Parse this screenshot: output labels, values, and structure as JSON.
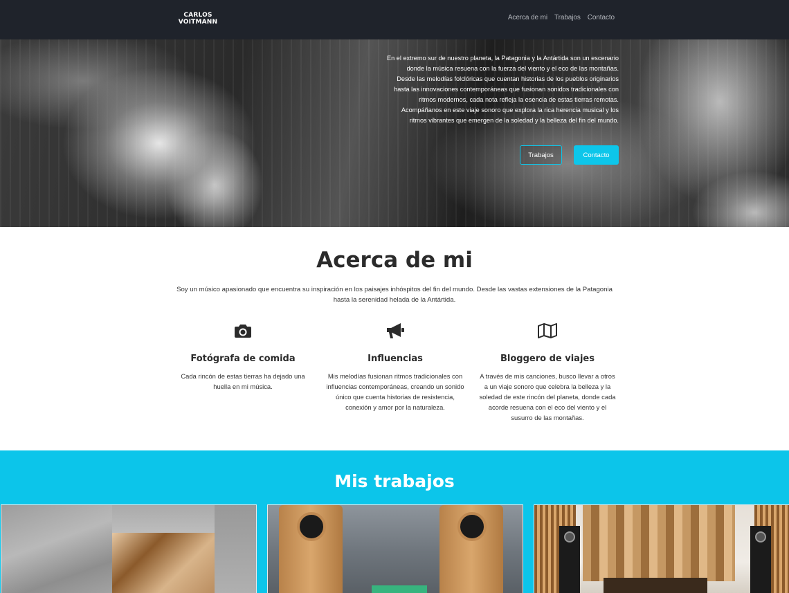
{
  "nav": {
    "logo_line1": "CARLOS",
    "logo_line2": "VOITMANN",
    "links": [
      "Acerca de mi",
      "Trabajos",
      "Contacto"
    ]
  },
  "hero": {
    "lines": [
      "En el extremo sur de nuestro planeta, la Patagonia y la Antártida son un escenario",
      "donde la música resuena con la fuerza del viento y el eco de las montañas.",
      "Desde las melodías folclóricas que cuentan historias de los pueblos originarios",
      "hasta las innovaciones contemporáneas que fusionan sonidos tradicionales con",
      "ritmos modernos, cada nota refleja la esencia de estas tierras remotas.",
      "Acompáñanos en este viaje sonoro que explora la rica herencia musical y los",
      "ritmos vibrantes que emergen de la soledad y la belleza del fin del mundo."
    ],
    "btn_works": "Trabajos",
    "btn_contact": "Contacto"
  },
  "about": {
    "title": "Acerca de mi",
    "lead": "Soy un músico apasionado que encuentra su inspiración en los paisajes inhóspitos del fin del mundo. Desde las vastas extensiones de la Patagonia hasta la serenidad helada de la Antártida.",
    "features": [
      {
        "icon": "camera-icon",
        "title": "Fotógrafa de comida",
        "text": "Cada rincón de estas tierras ha dejado una huella en mi música."
      },
      {
        "icon": "megaphone-icon",
        "title": "Influencias",
        "text": "Mis melodías fusionan ritmos tradicionales con influencias contemporáneas, creando un sonido único que cuenta historias de resistencia, conexión y amor por la naturaleza."
      },
      {
        "icon": "map-icon",
        "title": "Bloggero de viajes",
        "text": "A través de mis canciones, busco llevar a otros a un viaje sonoro que celebra la belleza y la soledad de este rincón del planeta, donde cada acorde resuena con el eco del viento y el susurro de las montañas."
      }
    ]
  },
  "works": {
    "title": "Mis trabajos"
  },
  "colors": {
    "accent": "#0dc6ea",
    "navbar": "#1f232b"
  }
}
